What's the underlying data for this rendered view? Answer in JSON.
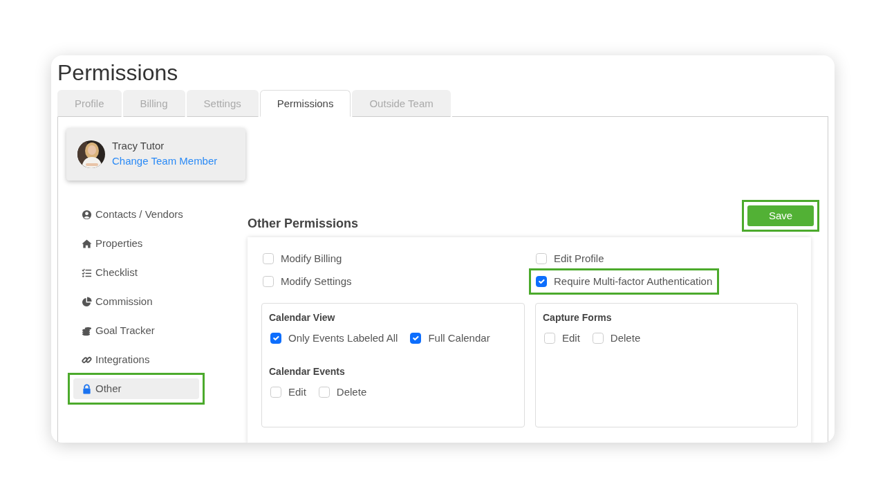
{
  "page_title": "Permissions",
  "tabs": [
    {
      "label": "Profile",
      "selected": false
    },
    {
      "label": "Billing",
      "selected": false
    },
    {
      "label": "Settings",
      "selected": false
    },
    {
      "label": "Permissions",
      "selected": true
    },
    {
      "label": "Outside Team",
      "selected": false
    }
  ],
  "member": {
    "name": "Tracy Tutor",
    "link": "Change Team Member"
  },
  "sidebar": {
    "items": [
      {
        "label": "Contacts / Vendors",
        "selected": false,
        "highlighted": false
      },
      {
        "label": "Properties",
        "selected": false,
        "highlighted": false
      },
      {
        "label": "Checklist",
        "selected": false,
        "highlighted": false
      },
      {
        "label": "Commission",
        "selected": false,
        "highlighted": false
      },
      {
        "label": "Goal Tracker",
        "selected": false,
        "highlighted": false
      },
      {
        "label": "Integrations",
        "selected": false,
        "highlighted": false
      },
      {
        "label": "Other",
        "selected": true,
        "highlighted": true
      }
    ]
  },
  "section_title": "Other Permissions",
  "save_button": {
    "label": "Save",
    "highlighted": true
  },
  "options": [
    {
      "label": "Modify Billing",
      "checked": false,
      "highlighted": false
    },
    {
      "label": "Edit Profile",
      "checked": false,
      "highlighted": false
    },
    {
      "label": "Modify Settings",
      "checked": false,
      "highlighted": false
    },
    {
      "label": "Require Multi-factor Authentication",
      "checked": true,
      "highlighted": true
    }
  ],
  "boxes": [
    {
      "groups": [
        {
          "title": "Calendar View",
          "options": [
            {
              "label": "Only Events Labeled All",
              "checked": true
            },
            {
              "label": "Full Calendar",
              "checked": true
            }
          ]
        },
        {
          "title": "Calendar Events",
          "options": [
            {
              "label": "Edit",
              "checked": false
            },
            {
              "label": "Delete",
              "checked": false
            }
          ]
        }
      ]
    },
    {
      "groups": [
        {
          "title": "Capture Forms",
          "options": [
            {
              "label": "Edit",
              "checked": false
            },
            {
              "label": "Delete",
              "checked": false
            }
          ]
        }
      ]
    }
  ]
}
